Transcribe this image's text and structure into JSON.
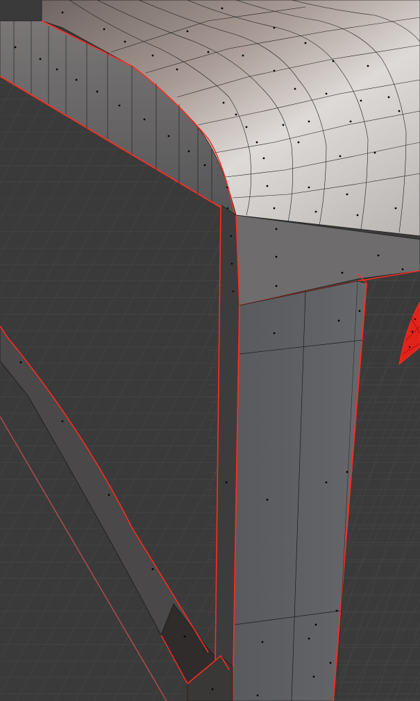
{
  "viewport": {
    "mode": "edit-mode",
    "view": "perspective",
    "selection_state": "partial",
    "overlay": {
      "grid_floor": true,
      "face_centers": true,
      "x_axis_line": true
    }
  },
  "colors": {
    "background": "#3a3a3a",
    "grid_line": "#474747",
    "grid_line_major": "#505050",
    "x_axis": "#b24a4e",
    "mesh_face": "#5c5c5e",
    "mesh_face_light": "#c9c5c2",
    "mesh_face_dark": "#2b2929",
    "mesh_wire": "#1a1a1a",
    "selected_edge": "#ff2b1e",
    "selected_face": "#e0231b",
    "face_dot": "#000000"
  },
  "icons": {
    "face_dot": "face-center-dot-icon",
    "selected_region": "selected-faces-indicator-icon"
  }
}
